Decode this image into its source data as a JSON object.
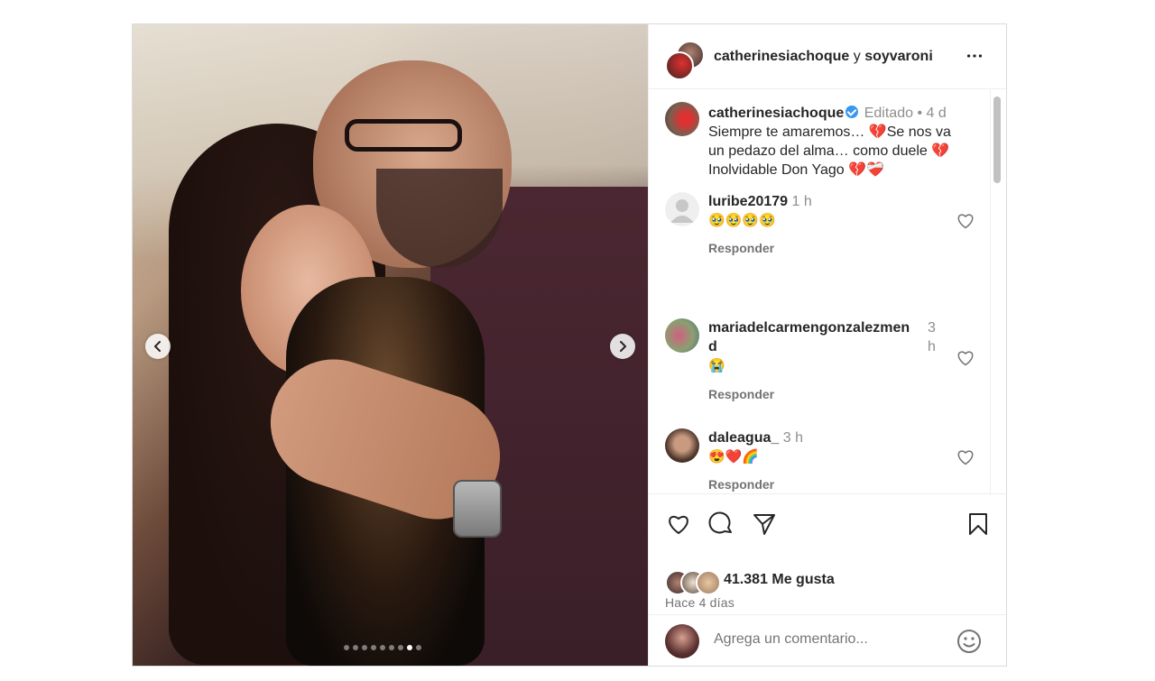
{
  "header": {
    "user1": "catherinesiachoque",
    "conj": "y",
    "user2": "soyvaroni"
  },
  "caption": {
    "username": "catherinesiachoque",
    "edited": "Editado",
    "sep": "•",
    "time": "4 d",
    "line1": "Siempre te amaremos… 💔Se nos va",
    "line2": "un pedazo del alma… como duele 💔",
    "line3": "Inolvidable Don Yago 💔❤️‍🩹"
  },
  "comments": [
    {
      "username": "luribe20179",
      "time": "1 h",
      "text": "🥹🥹🥹🥹",
      "reply": "Responder"
    },
    {
      "username": "mariadelcarmengonzalezmen",
      "username_cont": "d",
      "time": "3",
      "time_cont": "h",
      "text": "😭",
      "reply": "Responder"
    },
    {
      "username": "daleagua_",
      "time": "3 h",
      "text": "😍❤️🌈",
      "reply": "Responder"
    }
  ],
  "footer": {
    "likes": "41.381 Me gusta",
    "time_ago": "Hace 4 días",
    "comment_placeholder": "Agrega un comentario..."
  },
  "carousel": {
    "total": 9,
    "active_index": 7
  },
  "icons": {
    "more": "more-options-icon",
    "like": "heart-icon",
    "comment": "comment-icon",
    "share": "share-icon",
    "save": "bookmark-icon",
    "emoji": "emoji-icon",
    "prev": "chevron-left-icon",
    "next": "chevron-right-icon"
  },
  "colors": {
    "verified": "#3897f0",
    "muted": "#737373",
    "text": "#262626"
  }
}
